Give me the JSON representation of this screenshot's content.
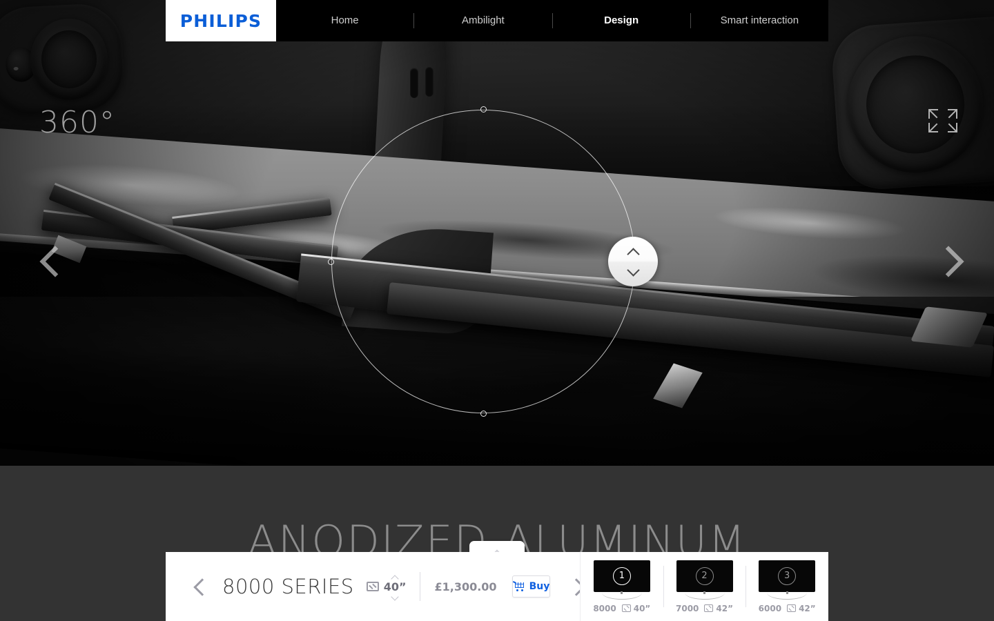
{
  "nav": {
    "brand": "PHILIPS",
    "items": [
      {
        "label": "Home",
        "active": false
      },
      {
        "label": "Ambilight",
        "active": false
      },
      {
        "label": "Design",
        "active": true
      },
      {
        "label": "Smart interaction",
        "active": false
      }
    ]
  },
  "hero": {
    "spin_label": "360°",
    "prev_icon": "chevron-left-icon",
    "next_icon": "chevron-right-icon",
    "expand_icon": "fullscreen-expand-icon",
    "rotate_up_icon": "chevron-up-icon",
    "rotate_down_icon": "chevron-down-icon"
  },
  "section": {
    "title": "ANODIZED ALUMINUM",
    "collapse_icon": "chevron-up-icon"
  },
  "product_bar": {
    "prev_icon": "chevron-left-icon",
    "next_icon": "chevron-right-icon",
    "series": "8000 SERIES",
    "size_icon": "screen-size-icon",
    "size": "40”",
    "step_up_icon": "chevron-up-icon",
    "step_down_icon": "chevron-down-icon",
    "price": "£1,300.00",
    "buy_label": "Buy",
    "cart_icon": "shopping-cart-icon"
  },
  "thumbnails": [
    {
      "number": "1",
      "series": "8000",
      "size": "40”",
      "selected": true,
      "size_icon": "screen-size-icon"
    },
    {
      "number": "2",
      "series": "7000",
      "size": "42”",
      "selected": false,
      "size_icon": "screen-size-icon"
    },
    {
      "number": "3",
      "series": "6000",
      "size": "42”",
      "selected": false,
      "size_icon": "screen-size-icon"
    }
  ],
  "colors": {
    "brand_blue": "#0b5ed7",
    "buy_blue": "#1060e0",
    "nav_bg": "#000000",
    "lower_bg": "#333333",
    "panel_bg": "#ffffff",
    "muted_text": "#9b9ba5",
    "title_text": "#8c8c8c"
  }
}
